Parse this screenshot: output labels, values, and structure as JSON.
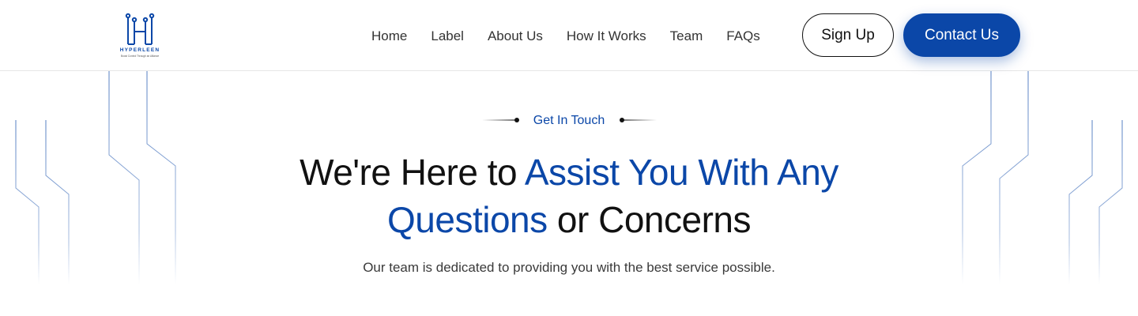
{
  "brand": {
    "name": "HYPERLEEN",
    "tagline": "Boost Control Through an Alliance",
    "accent_color": "#0b47a8"
  },
  "nav": {
    "items": [
      {
        "label": "Home"
      },
      {
        "label": "Label"
      },
      {
        "label": "About Us"
      },
      {
        "label": "How It Works"
      },
      {
        "label": "Team"
      },
      {
        "label": "FAQs"
      }
    ]
  },
  "actions": {
    "signup_label": "Sign Up",
    "contact_label": "Contact Us"
  },
  "hero": {
    "eyebrow": "Get In Touch",
    "headline_part1": "We're Here to ",
    "headline_accent1": "Assist You With Any",
    "headline_accent2": "Questions",
    "headline_part2": " or Concerns",
    "subtitle": "Our team is dedicated to providing you with the best service possible."
  }
}
